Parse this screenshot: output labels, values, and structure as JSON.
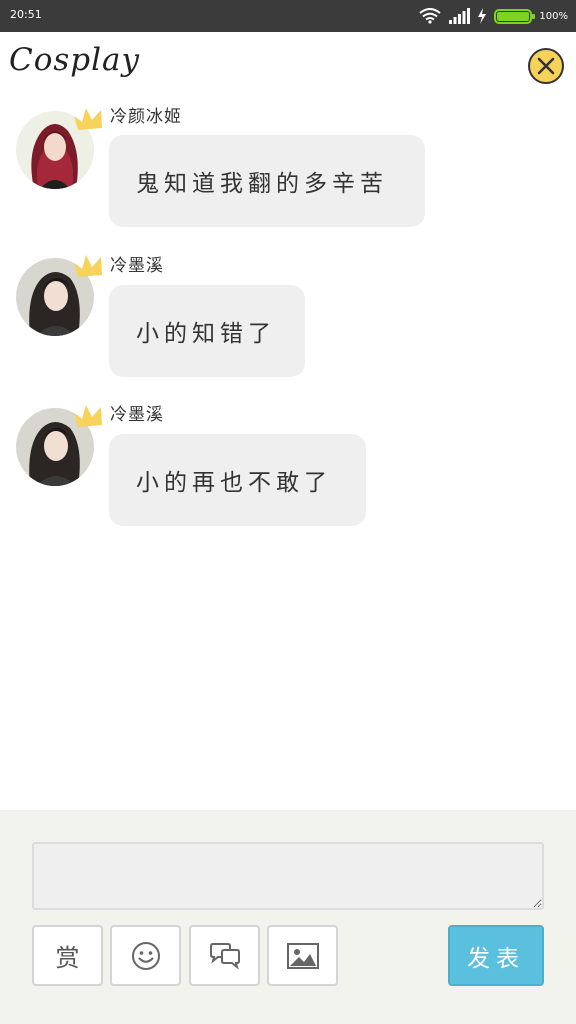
{
  "status_bar": {
    "time": "20:51",
    "battery_text": "100%",
    "battery_level": 1.0,
    "icons": [
      "wifi-icon",
      "signal-icon",
      "charging-icon",
      "battery-icon"
    ]
  },
  "header": {
    "title": "Cosplay",
    "close_icon": "close-icon"
  },
  "messages": [
    {
      "username": "冷颜冰姬",
      "text": "鬼知道我翻的多辛苦",
      "avatar": "avatar-red-hair",
      "badge": "crown-icon"
    },
    {
      "username": "冷墨溪",
      "text": "小的知错了",
      "avatar": "avatar-dark-hair",
      "badge": "crown-icon"
    },
    {
      "username": "冷墨溪",
      "text": "小的再也不敢了",
      "avatar": "avatar-dark-hair",
      "badge": "crown-icon"
    }
  ],
  "composer": {
    "input_value": "",
    "reward_label": "赏",
    "emoji_icon": "smiley-icon",
    "chat_icon": "speech-bubbles-icon",
    "image_icon": "image-icon",
    "submit_label": "发表"
  },
  "colors": {
    "status_bar": "#3b3b3b",
    "battery": "#7ed321",
    "close_button": "#f6d25a",
    "bubble": "#efefef",
    "panel": "#f3f3ee",
    "submit": "#5bbfde",
    "crown": "#f7d35c"
  }
}
